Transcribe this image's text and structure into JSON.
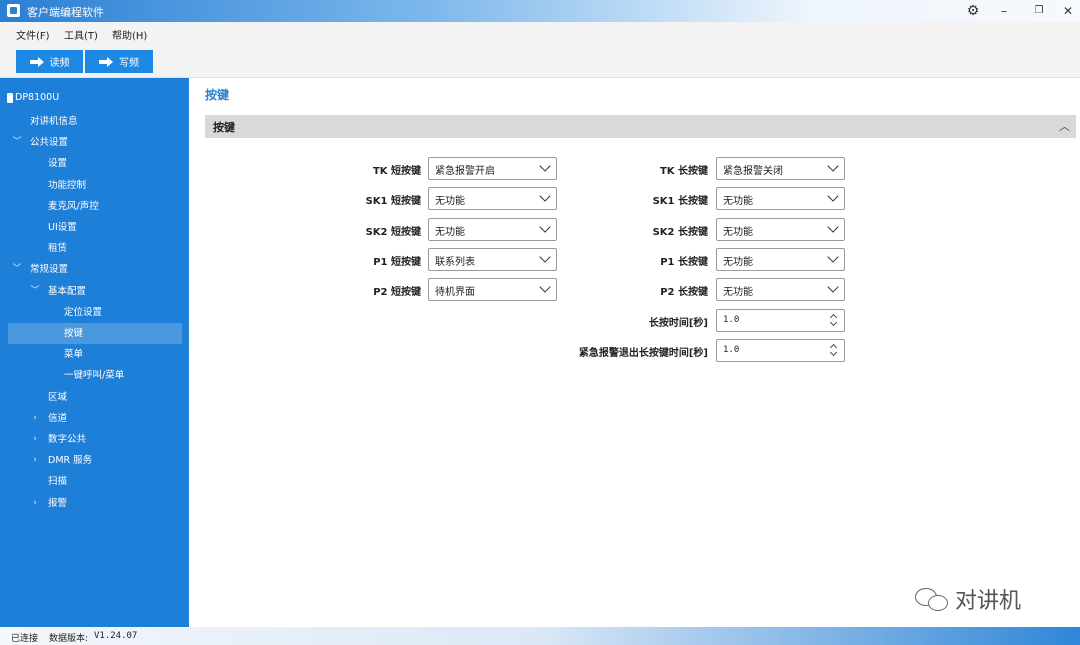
{
  "app": {
    "title": "客户端编程软件"
  },
  "menu": {
    "items": [
      "文件(F)",
      "工具(T)",
      "帮助(H)"
    ]
  },
  "toolbar": {
    "read_label": "读频",
    "write_label": "写频"
  },
  "sidebar": {
    "device": "DP8100U",
    "items": [
      {
        "label": "对讲机信息",
        "level": 0,
        "chevron": ""
      },
      {
        "label": "公共设置",
        "level": 0,
        "chevron": "﹀"
      },
      {
        "label": "设置",
        "level": 1,
        "chevron": ""
      },
      {
        "label": "功能控制",
        "level": 1,
        "chevron": ""
      },
      {
        "label": "麦克风/声控",
        "level": 1,
        "chevron": ""
      },
      {
        "label": "UI设置",
        "level": 1,
        "chevron": ""
      },
      {
        "label": "租赁",
        "level": 1,
        "chevron": ""
      },
      {
        "label": "常规设置",
        "level": 0,
        "chevron": "﹀"
      },
      {
        "label": "基本配置",
        "level": 1,
        "chevron": "﹀"
      },
      {
        "label": "定位设置",
        "level": 2,
        "chevron": ""
      },
      {
        "label": "按键",
        "level": 2,
        "chevron": "",
        "active": true
      },
      {
        "label": "菜单",
        "level": 2,
        "chevron": ""
      },
      {
        "label": "一键呼叫/菜单",
        "level": 2,
        "chevron": ""
      },
      {
        "label": "区域",
        "level": 1,
        "chevron": ""
      },
      {
        "label": "信道",
        "level": 1,
        "chevron": "›"
      },
      {
        "label": "数字公共",
        "level": 1,
        "chevron": "›"
      },
      {
        "label": "DMR 服务",
        "level": 1,
        "chevron": "›"
      },
      {
        "label": "扫描",
        "level": 1,
        "chevron": ""
      },
      {
        "label": "报警",
        "level": 1,
        "chevron": "›"
      }
    ]
  },
  "main": {
    "page_title": "按键",
    "section_title": "按键",
    "short_press": [
      {
        "label": "TK 短按键",
        "value": "紧急报警开启"
      },
      {
        "label": "SK1 短按键",
        "value": "无功能"
      },
      {
        "label": "SK2 短按键",
        "value": "无功能"
      },
      {
        "label": "P1 短按键",
        "value": "联系列表"
      },
      {
        "label": "P2 短按键",
        "value": "待机界面"
      }
    ],
    "long_press": [
      {
        "label": "TK 长按键",
        "value": "紧急报警关闭"
      },
      {
        "label": "SK1 长按键",
        "value": "无功能"
      },
      {
        "label": "SK2 长按键",
        "value": "无功能"
      },
      {
        "label": "P1 长按键",
        "value": "无功能"
      },
      {
        "label": "P2 长按键",
        "value": "无功能"
      }
    ],
    "long_press_time": {
      "label": "长按时间[秒]",
      "value": "1.0"
    },
    "emergency_exit_time": {
      "label": "紧急报警退出长按键时间[秒]",
      "value": "1.0"
    },
    "watermark": "对讲机"
  },
  "status": {
    "connection": "已连接",
    "version_label": "数据版本:",
    "version_value": "V1.24.07"
  }
}
